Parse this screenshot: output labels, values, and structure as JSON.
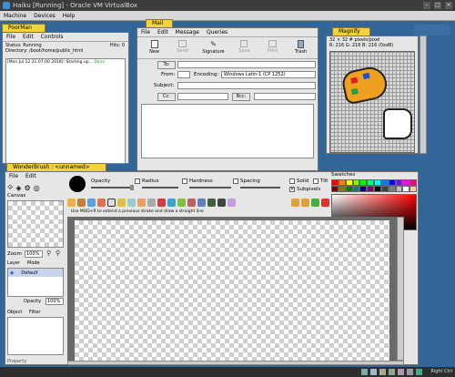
{
  "vbox": {
    "title": "Haiku [Running] - Oracle VM VirtualBox",
    "menu": [
      "Machine",
      "Devices",
      "Help"
    ],
    "right_ctrl": "Right Ctrl"
  },
  "poorman": {
    "tab": "PoorMan",
    "menu": [
      "File",
      "Edit",
      "Controls"
    ],
    "status": "Status: Running",
    "hits": "Hits: 0",
    "dir": "Directory: /boot/home/public_html",
    "log": "[Mon Jul 12 21:07:00 2018]: Starting up...",
    "log_done": "Done"
  },
  "mail": {
    "tab": "Mail",
    "menu": [
      "File",
      "Edit",
      "Message",
      "Queries"
    ],
    "toolbar": [
      "New",
      "Send",
      "Signature",
      "Save",
      "Print",
      "Trash"
    ],
    "to": "To:",
    "from": "From:",
    "encoding_label": "Encoding:",
    "encoding_value": "Windows Latin-1 (CP 1252)",
    "subject": "Subject:",
    "cc": "Cc:",
    "bcc": "Bcc:"
  },
  "magnify": {
    "tab": "Magnify",
    "info1": "32 × 32  # pixels/pixel",
    "info2": "R: 216 G: 216 B: 216 (0xd8)"
  },
  "wonderbrush": {
    "tab": "WonderBrush : <unnamed>",
    "menu": [
      "File",
      "Edit"
    ],
    "canvas_label": "Canvas",
    "opacity_label": "Opacity",
    "radius_label": "Radius",
    "hardness_label": "Hardness",
    "spacing_label": "Spacing",
    "solid_label": "Solid",
    "tilt_label": "Tilt",
    "subpixels_label": "Subpixels",
    "swatches_label": "Swatches",
    "hint": "Use MOD+R to extend a previous stroke and draw a straight line",
    "zoom_label": "Zoom",
    "zoom_value": "100%",
    "layer_label": "Layer",
    "mode_label": "Mode",
    "layer_name": "Default",
    "layer_opacity_label": "Opacity",
    "layer_opacity_value": "100%",
    "object_label": "Object",
    "filter_label": "Filter",
    "property_label": "Property"
  },
  "colors": {
    "desktop": "#336698",
    "tab_yellow": "#f3d23c",
    "swatches": [
      "#ff0000",
      "#ff8000",
      "#ffff00",
      "#80ff00",
      "#00ff00",
      "#00ff80",
      "#00ffff",
      "#0080ff",
      "#0000ff",
      "#8000ff",
      "#ff00ff",
      "#ff0080",
      "#800000",
      "#808000",
      "#008000",
      "#008080",
      "#000080",
      "#800080",
      "#000000",
      "#404040",
      "#808080",
      "#c0c0c0",
      "#ffffff",
      "#ffcc99"
    ]
  }
}
